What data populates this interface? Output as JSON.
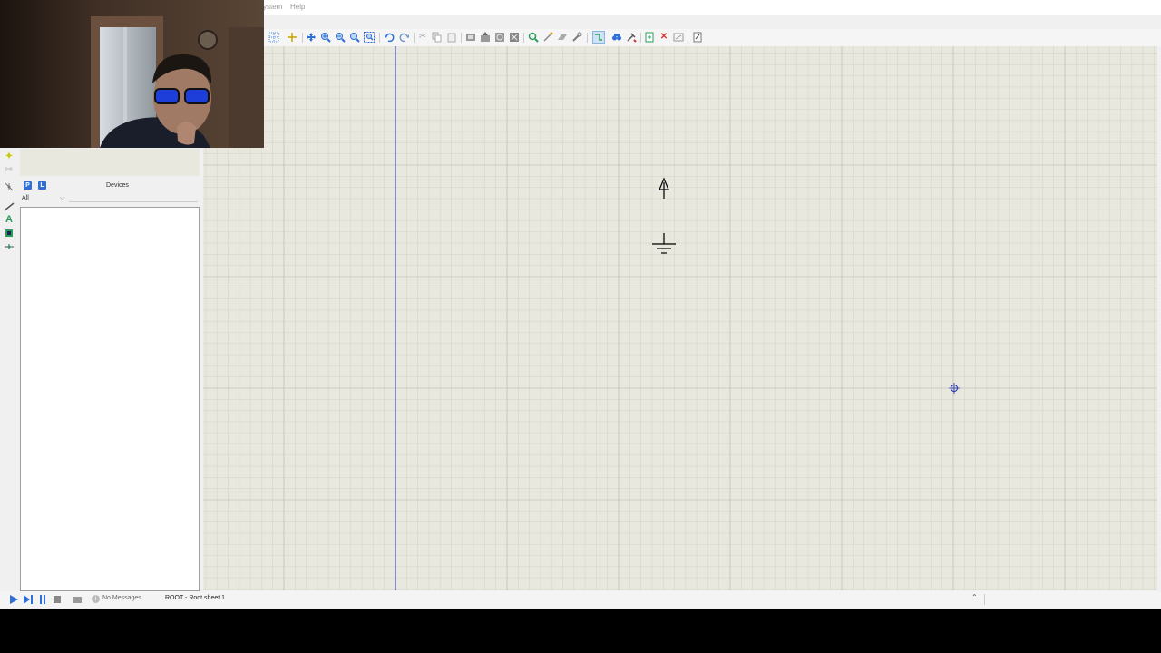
{
  "menu": {
    "system_label": "ystem",
    "help_label": "Help"
  },
  "toolbar": {
    "icons": [
      "grid-icon",
      "origin-icon",
      "pan-icon",
      "zoom-in-icon",
      "zoom-out-icon",
      "zoom-all-icon",
      "zoom-area-icon",
      "undo-icon",
      "redo-icon",
      "cut-icon",
      "copy-icon",
      "paste-icon",
      "block-copy-icon",
      "block-move-icon",
      "block-rotate-icon",
      "block-delete-icon",
      "pick-device-icon",
      "make-device-icon",
      "package-icon",
      "decompose-icon",
      "wire-autorouter-icon",
      "search-icon",
      "property-tool-icon",
      "new-sheet-icon",
      "remove-sheet-icon",
      "exit-parent-icon",
      "bom-icon"
    ]
  },
  "left_tools": [
    "selection-mode-icon",
    "component-mode-icon",
    "junction-icon",
    "wire-label-icon",
    "text-script-icon",
    "bus-icon",
    "subcircuit-icon"
  ],
  "panel": {
    "pick_button": "P",
    "library_button": "L",
    "title": "Devices",
    "filter_value": "All"
  },
  "status": {
    "messages": "No Messages",
    "sheet": "ROOT - Root sheet 1",
    "info_glyph": "i"
  },
  "colors": {
    "canvas_bg": "#e8e8de",
    "grid_minor": "#d6d6ca",
    "grid_major": "#b4b4a8",
    "origin_line": "#2233aa",
    "accent_blue": "#2f6fd6"
  }
}
